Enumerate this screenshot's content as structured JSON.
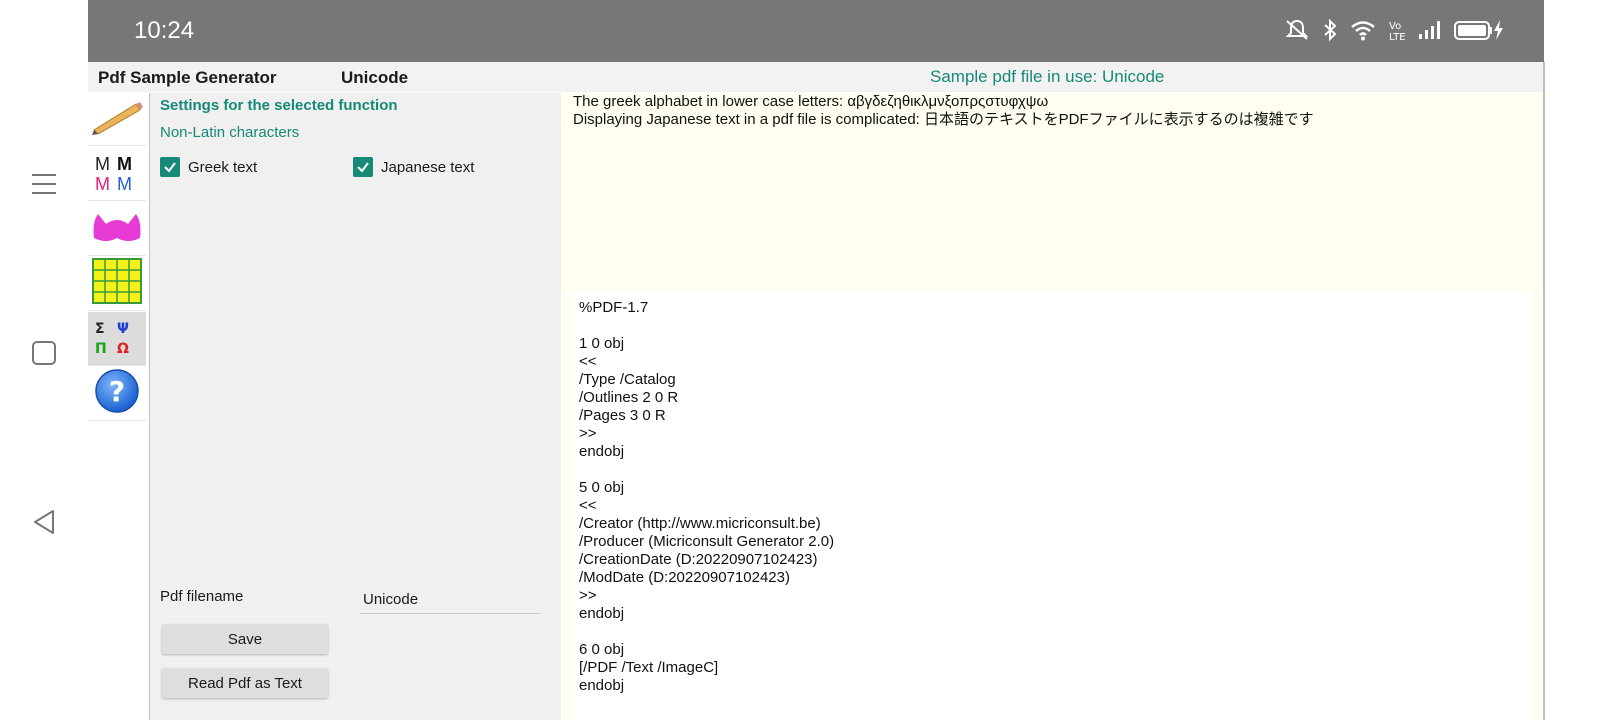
{
  "status_bar": {
    "time": "10:24"
  },
  "app": {
    "title": "Pdf Sample Generator",
    "function_title": "Unicode",
    "sample_in_use": "Sample pdf file in use: Unicode"
  },
  "toolbar": {
    "items": [
      {
        "icon": "pencil-icon"
      },
      {
        "icon": "font-styles-icon",
        "glyphs": [
          "M",
          "M",
          "M",
          "M"
        ]
      },
      {
        "icon": "shapes-icon"
      },
      {
        "icon": "table-icon"
      },
      {
        "icon": "unicode-symbols-icon",
        "glyphs": [
          "Σ",
          "Ψ",
          "Π",
          "Ω"
        ]
      },
      {
        "icon": "help-icon"
      }
    ]
  },
  "settings": {
    "title": "Settings for the selected function",
    "subtitle": "Non-Latin characters",
    "greek": {
      "label": "Greek text",
      "checked": true
    },
    "japanese": {
      "label": "Japanese text",
      "checked": true
    },
    "filename_label": "Pdf filename",
    "filename_value": "Unicode",
    "save_label": "Save",
    "read_label": "Read Pdf as Text"
  },
  "content": {
    "greek_line": "The greek alphabet in lower case letters: αβγδεζηθικλμνξοπρςστυφχψω",
    "japanese_line": "Displaying Japanese text in a pdf file is complicated: 日本語のテキストをPDFファイルに表示するのは複雑です",
    "pdf_lines": [
      "%PDF-1.7",
      "",
      "1 0 obj",
      "<<",
      "/Type /Catalog",
      "/Outlines 2 0 R",
      "/Pages 3 0 R",
      ">>",
      "endobj",
      "",
      "5 0 obj",
      "<<",
      "/Creator (http://www.micriconsult.be)",
      "/Producer (Micriconsult Generator 2.0)",
      "/CreationDate (D:20220907102423)",
      "/ModDate (D:20220907102423)",
      ">>",
      "endobj",
      "",
      "6 0 obj",
      "[/PDF /Text /ImageC]",
      "endobj"
    ]
  },
  "colors": {
    "accent": "#168a77",
    "status_bar": "#777777",
    "content_bg": "#fffef1"
  }
}
